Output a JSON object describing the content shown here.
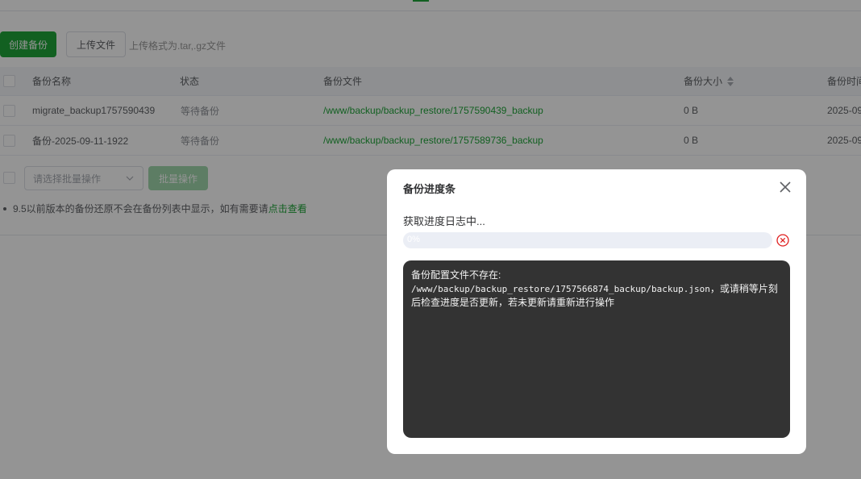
{
  "toolbar": {
    "create_backup_label": "创建备份",
    "upload_file_label": "上传文件",
    "upload_tip": "上传格式为.tar,.gz文件"
  },
  "table": {
    "headers": {
      "name": "备份名称",
      "status": "状态",
      "file": "备份文件",
      "size": "备份大小",
      "time": "备份时间"
    },
    "rows": [
      {
        "name": "migrate_backup1757590439",
        "status": "等待备份",
        "file": "/www/backup/backup_restore/1757590439_backup",
        "size": "0 B",
        "time": "2025-09"
      },
      {
        "name": "备份-2025-09-11-1922",
        "status": "等待备份",
        "file": "/www/backup/backup_restore/1757589736_backup",
        "size": "0 B",
        "time": "2025-09"
      }
    ]
  },
  "batch": {
    "select_placeholder": "请选择批量操作",
    "button_label": "批量操作"
  },
  "note": {
    "text": "9.5以前版本的备份还原不会在备份列表中显示，如有需要请",
    "link": "点击查看"
  },
  "dialog": {
    "title": "备份进度条",
    "status_text": "获取进度日志中...",
    "progress_percent": 0,
    "progress_label": "0%",
    "log_line1": "备份配置文件不存在:",
    "log_path": "/www/backup/backup_restore/1757566874_backup/backup.json",
    "log_line2_suffix": "，或请稍等片刻",
    "log_line3": "后检查进度是否更新，若未更新请重新进行操作"
  },
  "colors": {
    "accent": "#20a53a",
    "danger": "#e02020",
    "log_bg": "#333333"
  }
}
